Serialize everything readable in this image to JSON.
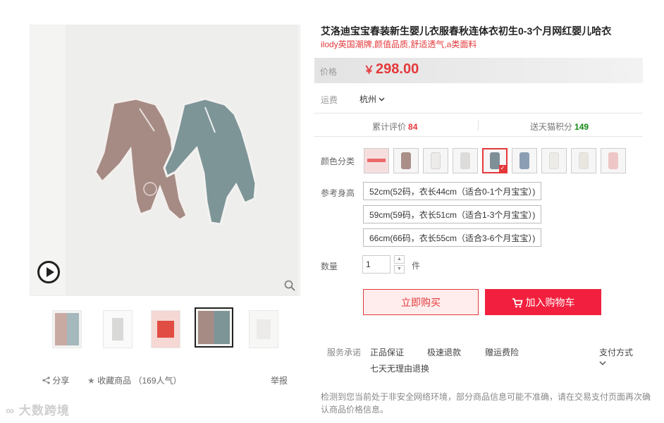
{
  "product": {
    "title": "艾洛迪宝宝春装新生婴儿衣服春秋连体衣初生0-3个月网红婴儿哈衣",
    "subtitle": "ilody英国潮牌,颜值品质,舒适透气,a类面料"
  },
  "price": {
    "label": "价格",
    "currency": "￥",
    "value": "298.00"
  },
  "shipping": {
    "label": "运费",
    "city": "杭州"
  },
  "stats": {
    "reviews_label": "累计评价",
    "reviews_count": "84",
    "points_label": "送天猫积分",
    "points_count": "149"
  },
  "color": {
    "label": "颜色分类",
    "swatches": [
      {
        "name": "促销图",
        "tone": "#f3d7d7"
      },
      {
        "name": "粉色",
        "tone": "#a98f88"
      },
      {
        "name": "白色印花",
        "tone": "#ecebea"
      },
      {
        "name": "白灰",
        "tone": "#dddcdb"
      },
      {
        "name": "灰蓝",
        "tone": "#7f8f98",
        "selected": true
      },
      {
        "name": "蓝色",
        "tone": "#8c9eb3"
      },
      {
        "name": "米白",
        "tone": "#ecebe6"
      },
      {
        "name": "奶白",
        "tone": "#e9e6df"
      },
      {
        "name": "浅粉",
        "tone": "#efc6c6"
      }
    ]
  },
  "height": {
    "label": "参考身高",
    "options": [
      "52cm(52码，衣长44cm（适合0-1个月宝宝）)",
      "59cm(59码，衣长51cm（适合1-3个月宝宝）)",
      "66cm(66码，衣长55cm（适合3-6个月宝宝）)"
    ]
  },
  "quantity": {
    "label": "数量",
    "value": "1",
    "unit": "件"
  },
  "actions": {
    "buy_now": "立即购买",
    "add_to_cart": "加入购物车"
  },
  "service": {
    "label": "服务承诺",
    "items": [
      "正品保证",
      "极速退款",
      "赠运费险",
      "七天无理由退换"
    ],
    "payment": "支付方式"
  },
  "notice": "检测到您当前处于非安全网络环境，部分商品信息可能不准确，请在交易支付页面再次确认商品价格信息。",
  "gallery": {
    "share": "分享",
    "favorite": "收藏商品",
    "popularity": "（169人气）",
    "report": "举报"
  },
  "watermark": "大数跨境",
  "colors": {
    "accent": "#e4393c",
    "cart_button": "#f2203e",
    "points_green": "#118811"
  }
}
